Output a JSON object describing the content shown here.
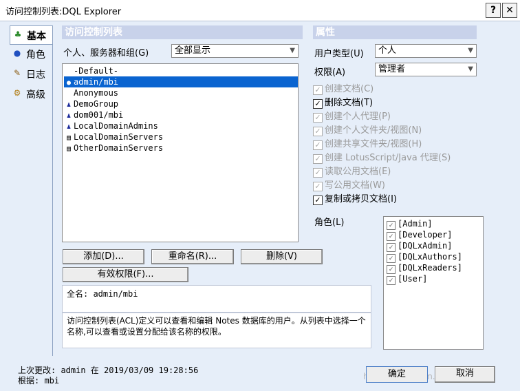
{
  "window": {
    "title": "访问控制列表:DQL Explorer",
    "help": "?",
    "close": "✕"
  },
  "left_tabs": [
    {
      "label": "基本",
      "icon": "♣"
    },
    {
      "label": "角色",
      "icon": "●"
    },
    {
      "label": "日志",
      "icon": "✎"
    },
    {
      "label": "高级",
      "icon": "⚙"
    }
  ],
  "acl": {
    "header": "访问控制列表",
    "filter_label": "个人、服务器和组(G)",
    "filter_value": "全部显示",
    "entries": [
      {
        "name": "-Default-",
        "icon": ""
      },
      {
        "name": "admin/mbi",
        "icon": "●"
      },
      {
        "name": "Anonymous",
        "icon": ""
      },
      {
        "name": "DemoGroup",
        "icon": "♟"
      },
      {
        "name": "dom001/mbi",
        "icon": "♟"
      },
      {
        "name": "LocalDomainAdmins",
        "icon": "♟"
      },
      {
        "name": "LocalDomainServers",
        "icon": "▤"
      },
      {
        "name": "OtherDomainServers",
        "icon": "▤"
      }
    ],
    "buttons": {
      "add": "添加(D)...",
      "rename": "重命名(R)...",
      "delete": "删除(V)",
      "effective": "有效权限(F)..."
    },
    "fullname": "全名: admin/mbi",
    "description": "访问控制列表(ACL)定义可以查看和编辑 Notes 数据库的用户。从列表中选择一个名称,可以查看或设置分配给该名称的权限。"
  },
  "attributes": {
    "header": "属性",
    "user_type_label": "用户类型(U)",
    "user_type_value": "个人",
    "access_label": "权限(A)",
    "access_value": "管理者",
    "permissions": [
      {
        "label": "创建文档(C)",
        "checked": "✓",
        "enabled": false
      },
      {
        "label": "删除文档(T)",
        "checked": "✓",
        "enabled": true
      },
      {
        "label": "创建个人代理(P)",
        "checked": "✓",
        "enabled": false
      },
      {
        "label": "创建个人文件夹/视图(N)",
        "checked": "✓",
        "enabled": false
      },
      {
        "label": "创建共享文件夹/视图(H)",
        "checked": "✓",
        "enabled": false
      },
      {
        "label": "创建 LotusScript/Java 代理(S)",
        "checked": "✓",
        "enabled": false
      },
      {
        "label": "读取公用文档(E)",
        "checked": "✓",
        "enabled": false
      },
      {
        "label": "写公用文档(W)",
        "checked": "✓",
        "enabled": false
      },
      {
        "label": "复制或拷贝文档(I)",
        "checked": "✓",
        "enabled": true
      }
    ],
    "roles_label": "角色(L)",
    "roles": [
      "[Admin]",
      "[Developer]",
      "[DQLxAdmin]",
      "[DQLxAuthors]",
      "[DQLxReaders]",
      "[User]"
    ],
    "role_check": "✓"
  },
  "status": {
    "last_modified": "上次更改: admin 在 2019/03/09 19:28:56",
    "root": "根据: mbi"
  },
  "footer": {
    "ok": "确定",
    "cancel": "取消",
    "watermark": "https://blog.csdn.net/ZZZ_2018"
  }
}
